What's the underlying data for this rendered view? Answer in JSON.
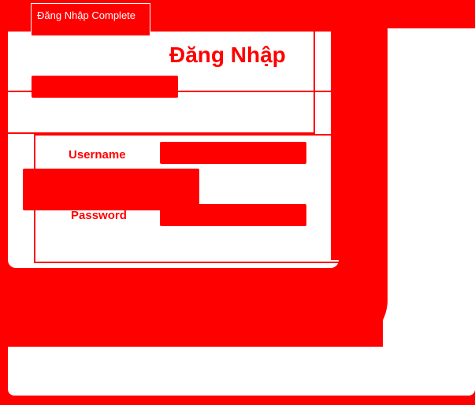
{
  "window": {
    "title": "Đăng Nhập Complete"
  },
  "form": {
    "heading": "Đăng Nhập",
    "username_label": "Username",
    "password_label": "Password",
    "username_value": "",
    "password_value": ""
  },
  "colors": {
    "accent": "#ff0000",
    "background": "#ffffff"
  }
}
